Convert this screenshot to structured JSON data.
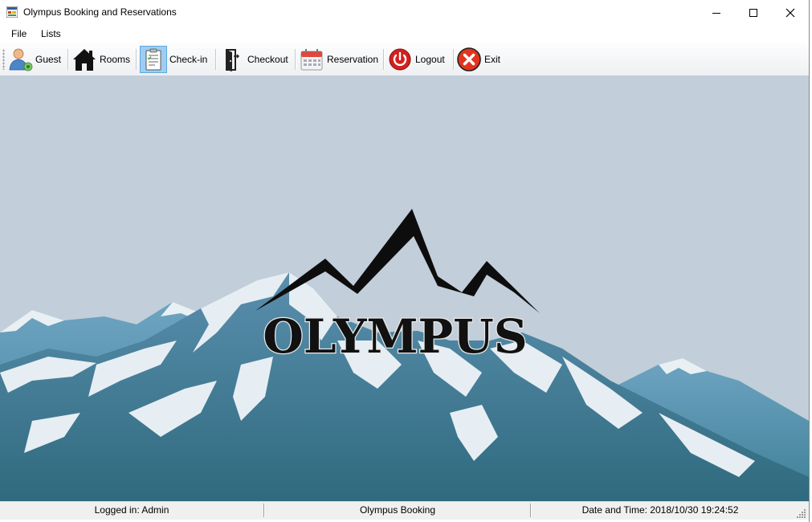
{
  "window": {
    "title": "Olympus Booking and Reservations",
    "title_icon": "app-icon",
    "controls": [
      "minimize-icon",
      "maximize-icon",
      "close-icon"
    ]
  },
  "menu": {
    "items": [
      {
        "label": "File"
      },
      {
        "label": "Lists"
      }
    ]
  },
  "toolbar": {
    "items": [
      {
        "label": "Guest",
        "icon": "guest-icon"
      },
      {
        "label": "Rooms",
        "icon": "house-icon"
      },
      {
        "label": "Check-in",
        "icon": "clipboard-icon",
        "active": true
      },
      {
        "label": "Checkout",
        "icon": "door-exit-icon"
      },
      {
        "label": "Reservation",
        "icon": "calendar-icon"
      },
      {
        "label": "Logout",
        "icon": "power-icon"
      },
      {
        "label": "Exit",
        "icon": "close-circle-icon"
      }
    ]
  },
  "main": {
    "logo_text": "OLYMPUS",
    "background": "#c2ced9"
  },
  "status": {
    "logged_in": "Logged in: Admin",
    "app_name": "Olympus Booking",
    "datetime": "Date and Time: 2018/10/30 19:24:52"
  },
  "colors": {
    "toolbar_active": "#9ecdf2",
    "mountain_dark": "#3f6f88",
    "mountain_snow": "#e6eef3",
    "sky": "#c2ced9"
  }
}
